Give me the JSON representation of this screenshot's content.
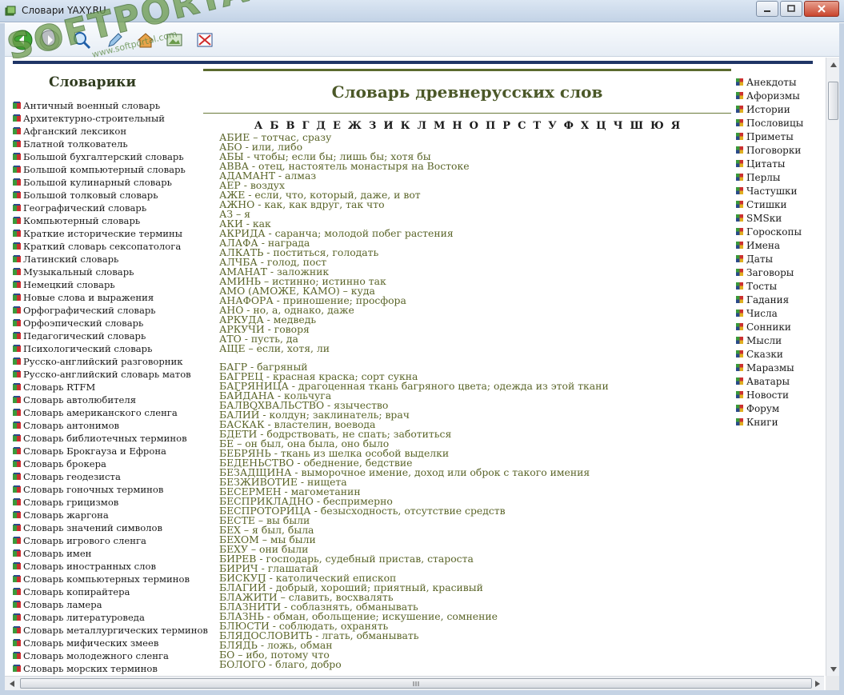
{
  "window": {
    "title": "Словари YAXY.RU"
  },
  "watermark": {
    "text": "SOFTPORTAL",
    "url": "www.softportal.com",
    "tm": "TM"
  },
  "left": {
    "heading": "Словарики",
    "items": [
      "Античный военный словарь",
      "Архитектурно-строительный",
      "Афганский лексикон",
      "Блатной толкователь",
      "Большой бухгалтерский словарь",
      "Большой компьютерный словарь",
      "Большой кулинарный словарь",
      "Большой толковый словарь",
      "Географический словарь",
      "Компьютерный словарь",
      "Краткие исторические термины",
      "Краткий словарь сексопатолога",
      "Латинский словарь",
      "Музыкальный словарь",
      "Немецкий словарь",
      "Новые слова и выражения",
      "Орфографический словарь",
      "Орфоэпический словарь",
      "Педагогический словарь",
      "Психологический словарь",
      "Русско-английский разговорник",
      "Русско-английский словарь матов",
      "Словарь RTFM",
      "Словарь автолюбителя",
      "Словарь американского сленга",
      "Словарь антонимов",
      "Словарь библиотечных терминов",
      "Словарь Брокгауза и Ефрона",
      "Словарь брокера",
      "Словарь геодезиста",
      "Словарь гоночных терминов",
      "Словарь грицизмов",
      "Словарь жаргона",
      "Словарь значений символов",
      "Словарь игрового сленга",
      "Словарь имен",
      "Словарь иностранных слов",
      "Словарь компьютерных терминов",
      "Словарь копирайтера",
      "Словарь ламера",
      "Словарь литературоведа",
      "Словарь металлургических терминов",
      "Словарь мифических змеев",
      "Словарь молодежного сленга",
      "Словарь морских терминов"
    ]
  },
  "center": {
    "title": "Словарь древнерусских слов",
    "alphabet": [
      "А",
      "Б",
      "В",
      "Г",
      "Д",
      "Е",
      "Ж",
      "З",
      "И",
      "К",
      "Л",
      "М",
      "Н",
      "О",
      "П",
      "Р",
      "С",
      "Т",
      "У",
      "Ф",
      "Х",
      "Ц",
      "Ч",
      "Ш",
      "Ю",
      "Я"
    ],
    "group_a": [
      "АБИЕ – тотчас, сразу",
      "АБО - или, либо",
      "АБЫ - чтобы; если бы; лишь бы; хотя бы",
      "АВВА - отец, настоятель монастыря на Востоке",
      "АДАМАНТ - алмаз",
      "АЕР - воздух",
      "АЖЕ - если, что, который, даже, и вот",
      "АЖНО - как, как вдруг, так что",
      "АЗ – я",
      "АКИ - как",
      "АКРИДА - саранча; молодой побег растения",
      "АЛАФА - награда",
      "АЛКАТЬ - поститься, голодать",
      "АЛЧБА - голод, пост",
      "АМАНАТ - заложник",
      "АМИНЬ – истинно; истинно так",
      "АМО (АМОЖЕ, КАМО) – куда",
      "АНАФОРА - приношение; просфора",
      "АНО - но, а, однако, даже",
      "АРКУДА - медведь",
      "АРКУЧИ - говоря",
      "АТО - пусть, да",
      "АЩЕ – если, хотя, ли"
    ],
    "group_b": [
      "БАГР - багряный",
      "БАГРЕЦ - красная краска; сорт сукна",
      "БАГРЯНИЦА - драгоценная ткань багряного цвета; одежда из этой ткани",
      "БАЙДАНА - кольчуга",
      "БАЛВОХВАЛЬСТВО - язычество",
      "БАЛИЙ - колдун; заклинатель; врач",
      "БАСКАК - властелин, воевода",
      "БДЕТИ - бодрствовать, не спать; заботиться",
      "БЕ – он был, она была, оно было",
      "БЕБРЯНЬ - ткань из шелка особой выделки",
      "БЕДЕНЬСТВО - обеднение, бедствие",
      "БЕЗАДЩИНА - выморочное имение, доход или оброк с такого имения",
      "БЕЗЖИВОТИЕ - нищета",
      "БЕСЕРМЕН - магометанин",
      "БЕСПРИКЛАДНО - беспримерно",
      "БЕСПРОТОРИЦА - безысходность, отсутствие средств",
      "БЕСТЕ – вы были",
      "БЕХ – я был, была",
      "БЕХОМ – мы были",
      "БЕХУ – они были",
      "БИРЕВ - господарь, судебный пристав, староста",
      "БИРИЧ - глашатай",
      "БИСКУП - католический епископ",
      "БЛАГИЙ - добрый, хороший; приятный, красивый",
      "БЛАЖИТИ – славить, восхвалять",
      "БЛАЗНИТИ - соблазнять, обманывать",
      "БЛАЗНЬ - обман, обольщение; искушение, сомнение",
      "БЛЮСТИ - соблюдать, охранять",
      "БЛЯДОСЛОВИТЬ - лгать, обманывать",
      "БЛЯДЬ - ложь, обман",
      "БО – ибо, потому что",
      "БОЛОГО - благо, добро"
    ]
  },
  "right": {
    "items": [
      "Анекдоты",
      "Афоризмы",
      "Истории",
      "Пословицы",
      "Приметы",
      "Поговорки",
      "Цитаты",
      "Перлы",
      "Частушки",
      "Стишки",
      "SMSки",
      "Гороскопы",
      "Имена",
      "Даты",
      "Заговоры",
      "Тосты",
      "Гадания",
      "Числа",
      "Сонники",
      "Мысли",
      "Сказки",
      "Маразмы",
      "Аватары",
      "Новости",
      "Форум",
      "Книги"
    ]
  },
  "colors": {
    "accent_bar": "#1f3566",
    "olive_text": "#5a6428",
    "title": "#4b5828"
  }
}
